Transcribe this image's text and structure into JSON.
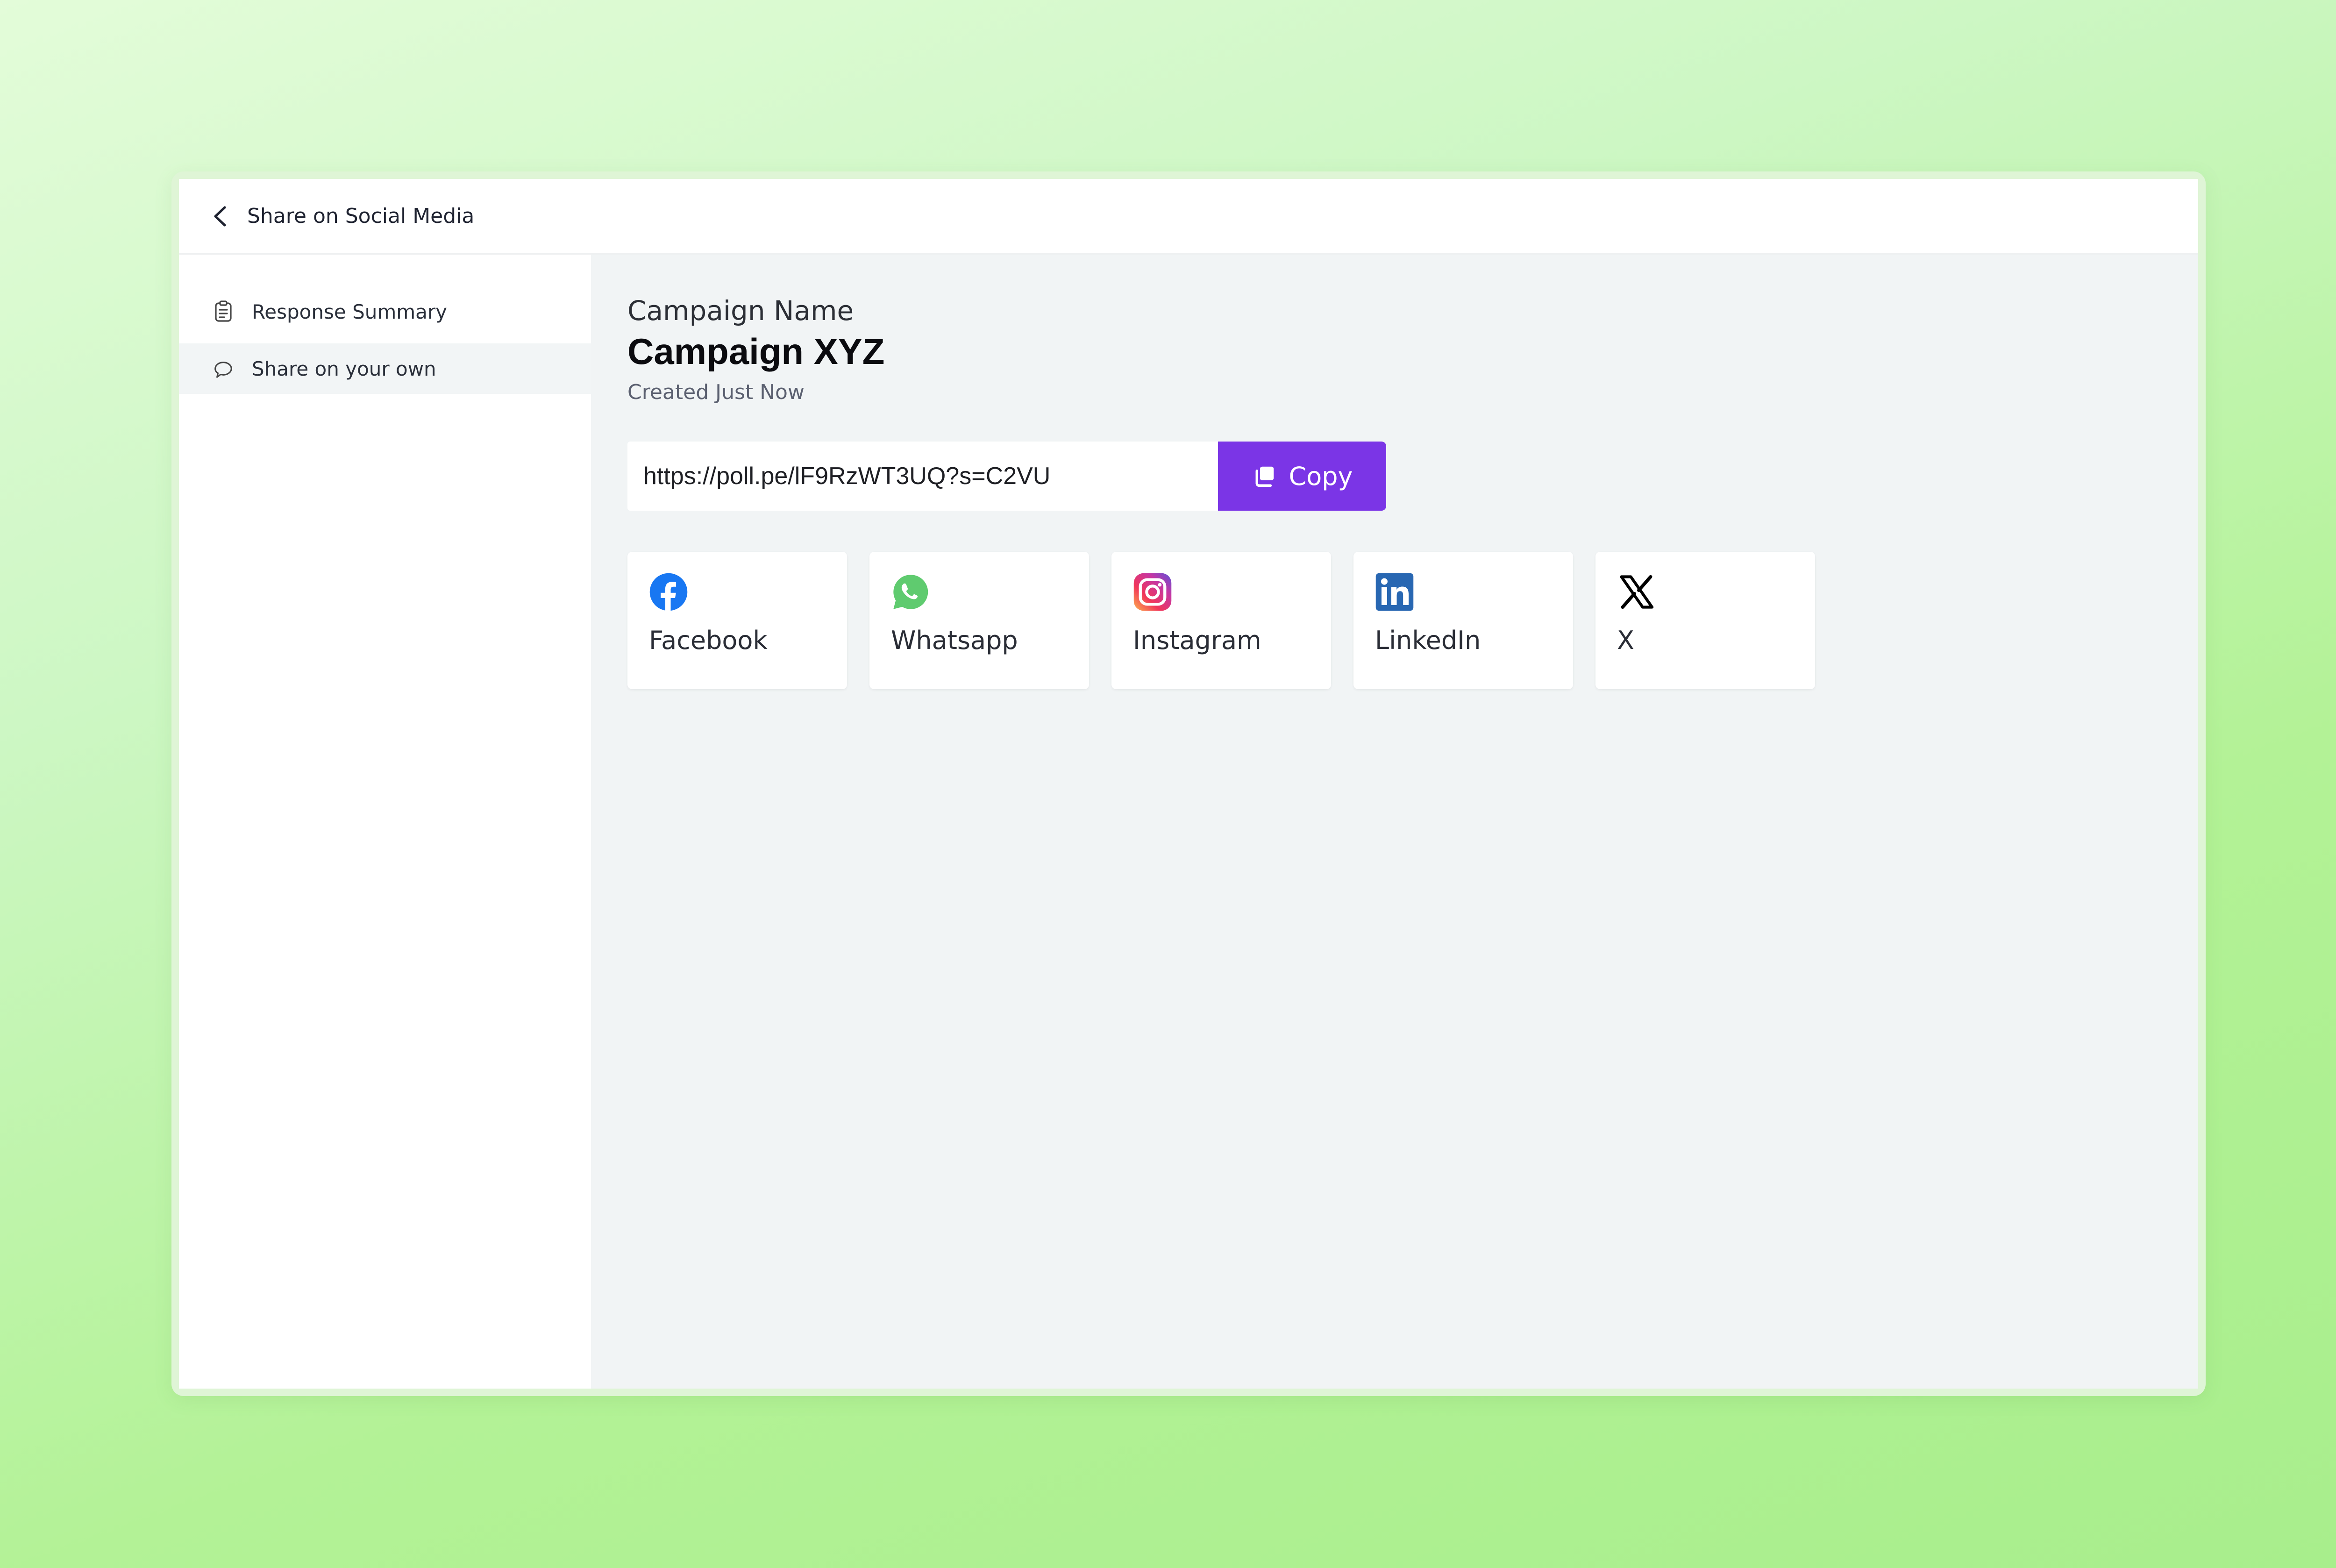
{
  "header": {
    "title": "Share on Social Media"
  },
  "sidebar": {
    "items": [
      {
        "label": "Response Summary",
        "icon": "clipboard-icon",
        "active": false
      },
      {
        "label": "Share on your own",
        "icon": "share-hand-icon",
        "active": true
      }
    ]
  },
  "campaign": {
    "label": "Campaign Name",
    "name": "Campaign XYZ",
    "created": "Created Just Now"
  },
  "share_link": {
    "value": "https://poll.pe/lF9RzWT3UQ?s=C2VU",
    "copy_label": "Copy"
  },
  "socials": [
    {
      "label": "Facebook",
      "icon": "facebook-icon",
      "color": "#1877F2"
    },
    {
      "label": "Whatsapp",
      "icon": "whatsapp-icon",
      "color": "#5FCB6F"
    },
    {
      "label": "Instagram",
      "icon": "instagram-icon",
      "color": "#D6249F"
    },
    {
      "label": "LinkedIn",
      "icon": "linkedin-icon",
      "color": "#2867B2"
    },
    {
      "label": "X",
      "icon": "x-icon",
      "color": "#000000"
    }
  ],
  "colors": {
    "accent": "#7B35E6",
    "main_bg": "#F1F4F5",
    "page_bg": "#C5F5B0"
  }
}
